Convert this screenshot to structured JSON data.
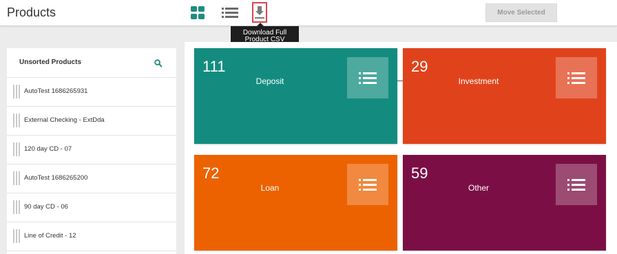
{
  "header": {
    "title": "Products",
    "move_label": "Move Selected",
    "download_tooltip_line1": "Download Full",
    "download_tooltip_line2": "Product CSV",
    "icons": {
      "grid": "grid-view-icon",
      "list": "list-view-icon",
      "download": "download-icon"
    },
    "accent_color": "#1f8c7f"
  },
  "sidebar": {
    "title": "Unsorted Products",
    "items": [
      {
        "label": "AutoTest 1686265931"
      },
      {
        "label": "External Checking  - ExtDda"
      },
      {
        "label": "120 day CD  - 07"
      },
      {
        "label": "AutoTest 1686265200"
      },
      {
        "label": "90 day CD  - 06"
      },
      {
        "label": "Line of Credit  - 12"
      }
    ]
  },
  "tiles": [
    {
      "count": "111",
      "label": "Deposit",
      "color": "#138c7f"
    },
    {
      "count": "29",
      "label": "Investment",
      "color": "#e0431c"
    },
    {
      "count": "72",
      "label": "Loan",
      "color": "#ec6200"
    },
    {
      "count": "59",
      "label": "Other",
      "color": "#7b0f45"
    }
  ]
}
